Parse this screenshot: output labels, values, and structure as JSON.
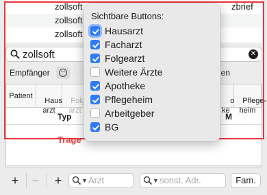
{
  "background_list": {
    "rows": [
      {
        "c1": "zollsoft",
        "c2": "zbrief"
      },
      {
        "c1": "zollsoft",
        "c2": ""
      },
      {
        "c1": "zollsoft",
        "c2": ""
      }
    ]
  },
  "search": {
    "value": "zollsoft",
    "clear_icon": "clear-circle-icon"
  },
  "recipients": {
    "label": "Empfänger",
    "right_fragment": "gen"
  },
  "table": {
    "headers": [
      "Patient",
      "Haus-\narzt",
      "Folge-\narzt",
      "o-\nke",
      "Pflege-\nheim"
    ],
    "sub_typ": "Typ",
    "sub_m": "M",
    "hint_fragment": "Trage"
  },
  "toolbar": {
    "add_label": "+",
    "remove_label": "−",
    "add2_label": "+",
    "doctor_placeholder": "Arzt",
    "other_placeholder": "sonst. Adr.",
    "family_label": "Fam."
  },
  "popover": {
    "title": "Sichtbare Buttons:",
    "options": [
      {
        "label": "Hausarzt",
        "checked": true,
        "focused": true
      },
      {
        "label": "Facharzt",
        "checked": true,
        "focused": false
      },
      {
        "label": "Folgearzt",
        "checked": true,
        "focused": false
      },
      {
        "label": "Weitere Ärzte",
        "checked": false,
        "focused": false
      },
      {
        "label": "Apotheke",
        "checked": true,
        "focused": false
      },
      {
        "label": "Pflegeheim",
        "checked": true,
        "focused": false
      },
      {
        "label": "Arbeitgeber",
        "checked": false,
        "focused": false
      },
      {
        "label": "BG",
        "checked": true,
        "focused": false
      }
    ]
  },
  "colors": {
    "accent": "#2f7cf6",
    "highlight_frame": "#e8363c",
    "hint_text": "#e23b3b"
  }
}
